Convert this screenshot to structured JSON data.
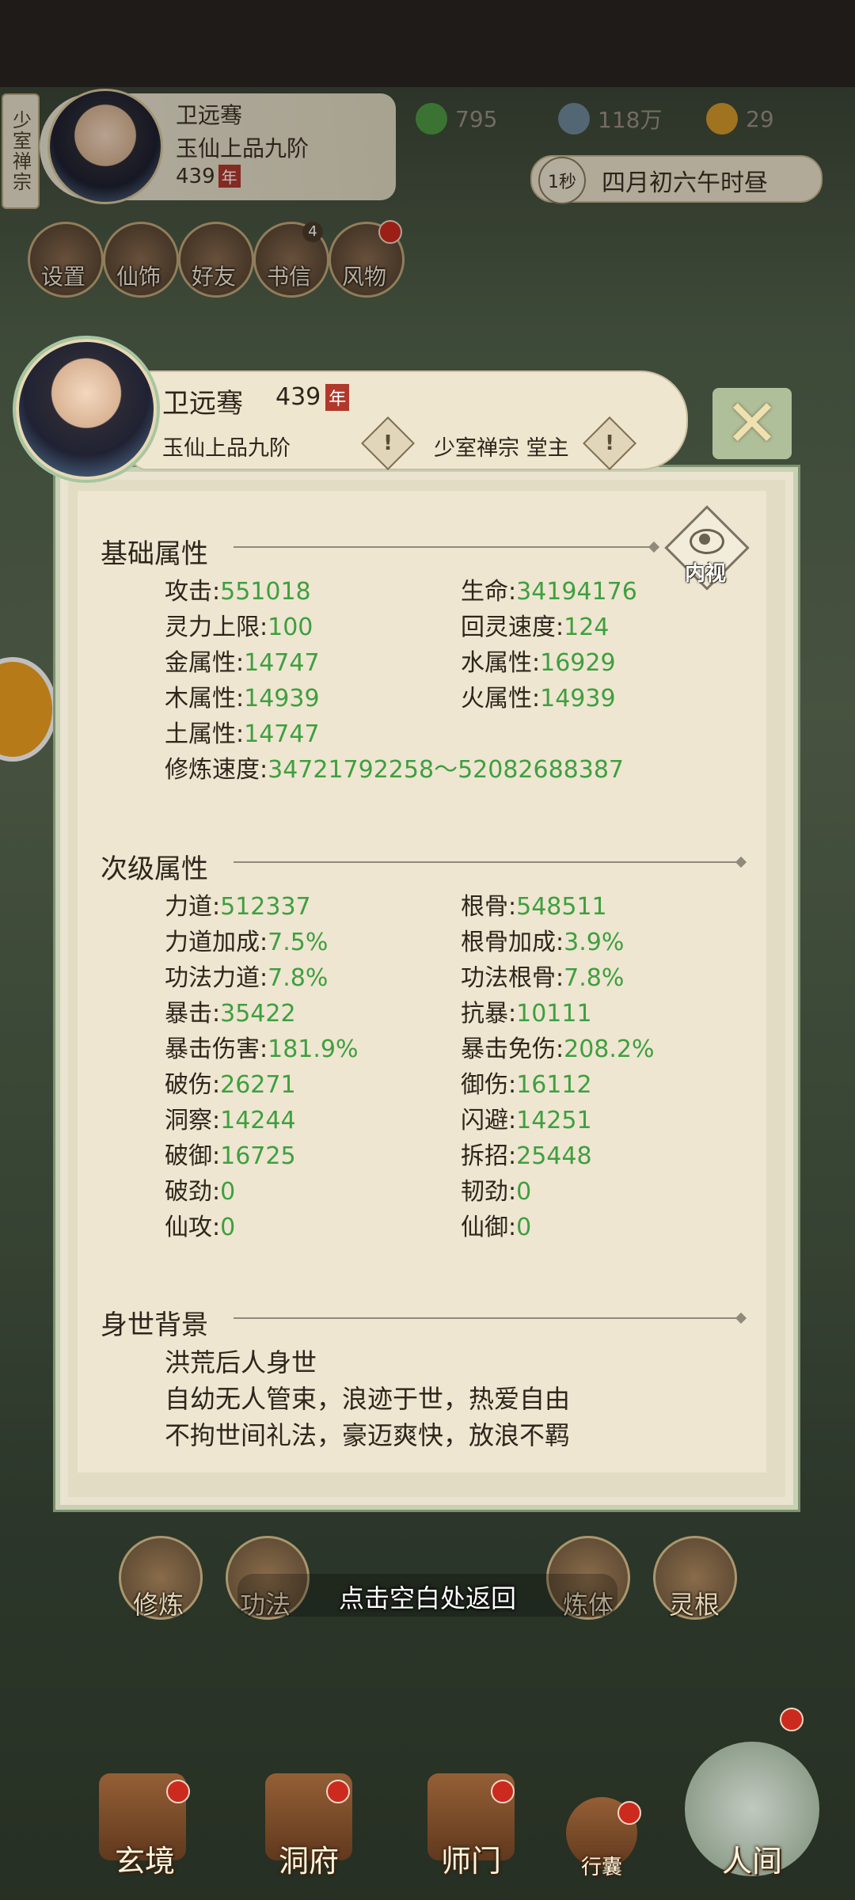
{
  "top": {
    "sect_tag": "少室禅宗",
    "player": {
      "name": "卫远骞",
      "rank": "玉仙上品九阶",
      "age": "439",
      "age_unit": "年"
    },
    "resources": [
      {
        "name": "jade-leaf",
        "value": "795",
        "color": "#4f9a44"
      },
      {
        "name": "coin",
        "value": "118万",
        "color": "#6e8a9a"
      },
      {
        "name": "gold-figure",
        "value": "29",
        "color": "#d49a2a"
      }
    ],
    "time_speed": "1秒",
    "time_text": "四月初六午时昼"
  },
  "menu": [
    {
      "label": "设置",
      "icon": "gear-icon"
    },
    {
      "label": "仙饰",
      "icon": "accessory-icon"
    },
    {
      "label": "好友",
      "icon": "friends-icon"
    },
    {
      "label": "书信",
      "icon": "mail-icon",
      "badge": "4"
    },
    {
      "label": "风物",
      "icon": "scenery-icon"
    }
  ],
  "profile": {
    "name": "卫远骞",
    "age": "439",
    "age_unit": "年",
    "rank": "玉仙上品九阶",
    "sect": "少室禅宗 堂主",
    "inner_view": "内视",
    "close": "✕"
  },
  "basic": {
    "title": "基础属性",
    "stats": [
      {
        "label": "攻击:",
        "value": "551018"
      },
      {
        "label": "生命:",
        "value": "34194176"
      },
      {
        "label": "灵力上限:",
        "value": "100"
      },
      {
        "label": "回灵速度:",
        "value": "124"
      },
      {
        "label": "金属性:",
        "value": "14747"
      },
      {
        "label": "水属性:",
        "value": "16929"
      },
      {
        "label": "木属性:",
        "value": "14939"
      },
      {
        "label": "火属性:",
        "value": "14939"
      },
      {
        "label": "土属性:",
        "value": "14747"
      }
    ],
    "cultivation_label": "修炼速度:",
    "cultivation_value": "34721792258～52082688387"
  },
  "secondary": {
    "title": "次级属性",
    "stats": [
      {
        "label": "力道:",
        "value": "512337"
      },
      {
        "label": "根骨:",
        "value": "548511"
      },
      {
        "label": "力道加成:",
        "value": "7.5%"
      },
      {
        "label": "根骨加成:",
        "value": "3.9%"
      },
      {
        "label": "功法力道:",
        "value": "7.8%"
      },
      {
        "label": "功法根骨:",
        "value": "7.8%"
      },
      {
        "label": "暴击:",
        "value": "35422"
      },
      {
        "label": "抗暴:",
        "value": "10111"
      },
      {
        "label": "暴击伤害:",
        "value": "181.9%"
      },
      {
        "label": "暴击免伤:",
        "value": "208.2%"
      },
      {
        "label": "破伤:",
        "value": "26271"
      },
      {
        "label": "御伤:",
        "value": "16112"
      },
      {
        "label": "洞察:",
        "value": "14244"
      },
      {
        "label": "闪避:",
        "value": "14251"
      },
      {
        "label": "破御:",
        "value": "16725"
      },
      {
        "label": "拆招:",
        "value": "25448"
      },
      {
        "label": "破劲:",
        "value": "0"
      },
      {
        "label": "韧劲:",
        "value": "0"
      },
      {
        "label": "仙攻:",
        "value": "0"
      },
      {
        "label": "仙御:",
        "value": "0"
      }
    ]
  },
  "background": {
    "title": "身世背景",
    "lines": [
      "洪荒后人身世",
      "自幼无人管束，浪迹于世，热爱自由",
      "不拘世间礼法，豪迈爽快，放浪不羁"
    ]
  },
  "hint": "点击空白处返回",
  "bottom_row": [
    {
      "label": "修炼"
    },
    {
      "label": "功法"
    },
    {
      "label": "炼体"
    },
    {
      "label": "灵根"
    }
  ],
  "nav": [
    {
      "label": "玄境"
    },
    {
      "label": "洞府"
    },
    {
      "label": "师门"
    },
    {
      "label": "行囊"
    },
    {
      "label": "人间"
    }
  ]
}
